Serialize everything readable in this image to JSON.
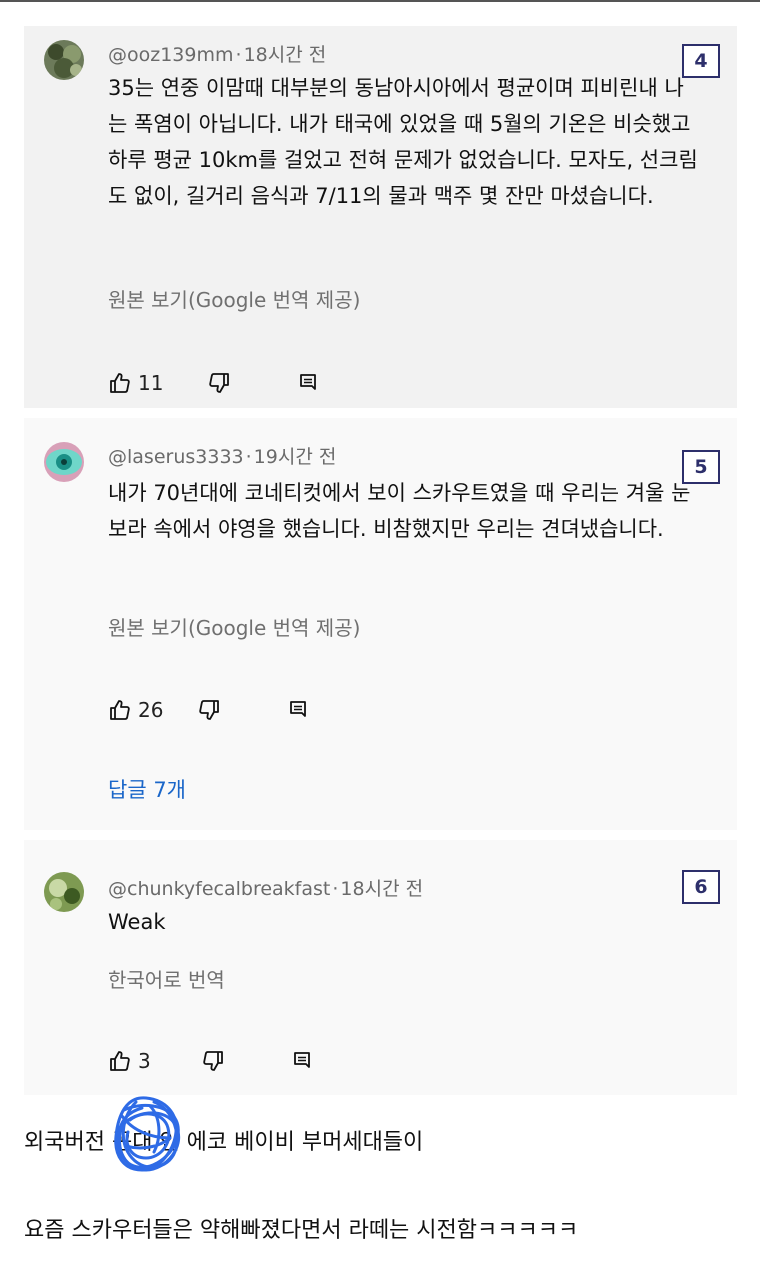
{
  "comments": [
    {
      "handle": "@ooz139mm",
      "separator": "·",
      "time": "18시간 전",
      "body": "35는 연중 이맘때 대부분의 동남아시아에서 평균이며 피비린내 나는 폭염이 아닙니다. 내가 태국에 있었을 때 5월의 기온은 비슷했고 하루 평균 10km를 걸었고 전혀 문제가 없었습니다. 모자도, 선크림도 없이, 길거리 음식과 7/11의 물과 맥주 몇 잔만 마셨습니다.",
      "translate": "원본 보기(Google 번역 제공)",
      "likes": "11",
      "label": "4",
      "avatar_color": "#4a5a3a"
    },
    {
      "handle": "@laserus3333",
      "separator": "·",
      "time": "19시간 전",
      "body": "내가 70년대에 코네티컷에서 보이 스카우트였을 때 우리는 겨울 눈보라 속에서 야영을 했습니다. 비참했지만 우리는 견뎌냈습니다.",
      "translate": "원본 보기(Google 번역 제공)",
      "likes": "26",
      "replies": "답글 7개",
      "label": "5",
      "avatar_color": "#2fb3a8"
    },
    {
      "handle": "@chunkyfecalbreakfast",
      "separator": "·",
      "time": "18시간 전",
      "body": "Weak",
      "translate": "한국어로 번역",
      "likes": "3",
      "label": "6",
      "avatar_color": "#5e7a3c"
    }
  ],
  "captions": {
    "line1": "외국버전 꼰대 인 에코 베이비 부머세대들이",
    "line2": "요즘 스카우터들은 약해빠졌다면서 라떼는 시전함ㅋㅋㅋㅋㅋ"
  },
  "colors": {
    "link": "#1a66c9",
    "label_border": "#2d2f6b",
    "scribble": "#2e6be6"
  }
}
